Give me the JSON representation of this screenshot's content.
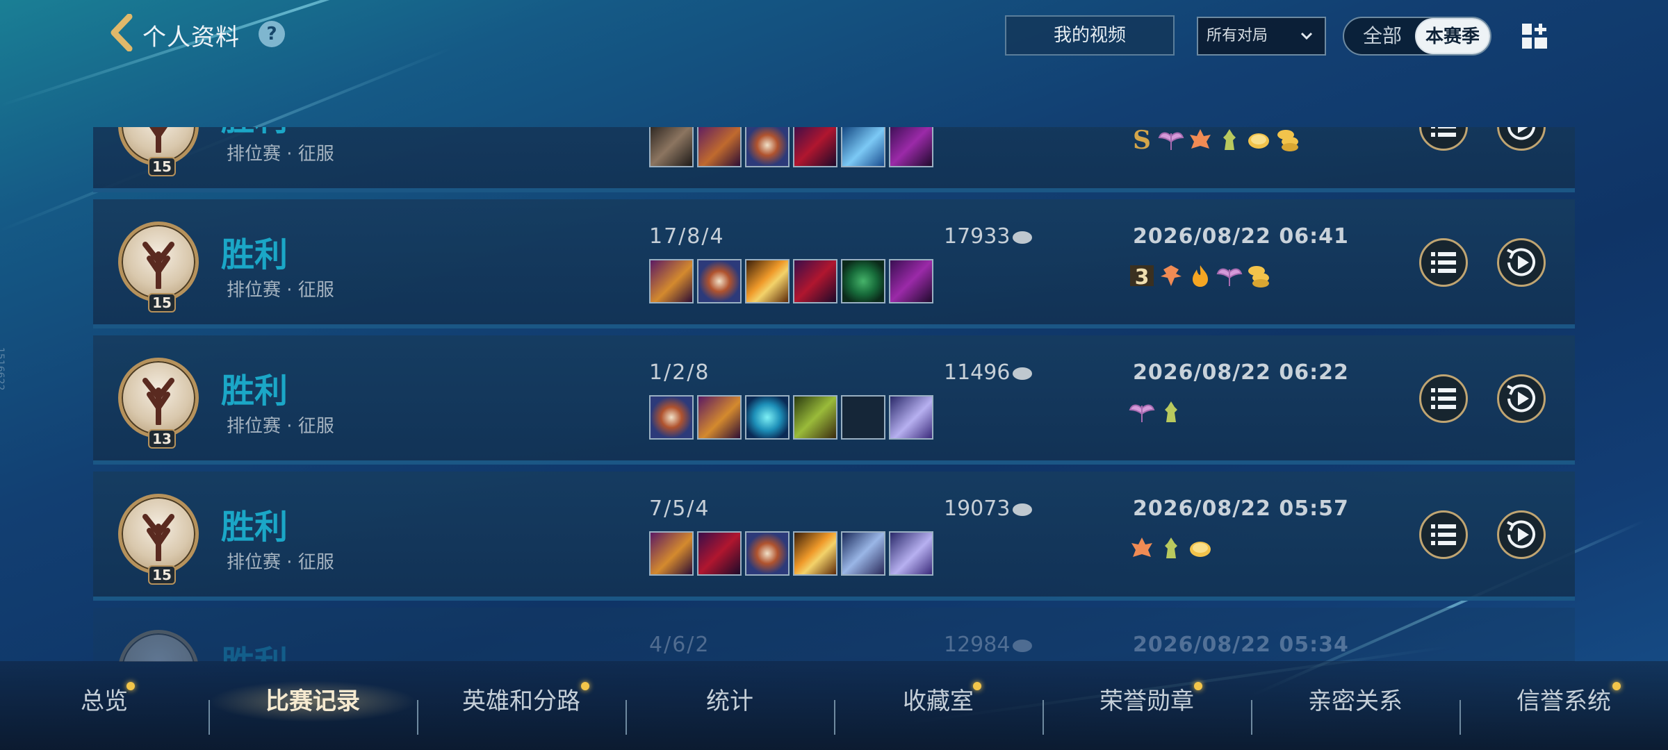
{
  "header": {
    "title": "个人资料",
    "help": "?",
    "my_videos": "我的视频",
    "filter": {
      "selected": "所有对局"
    },
    "toggle": {
      "all": "全部",
      "season": "本赛季"
    }
  },
  "matches": [
    {
      "result": "胜利",
      "mode": "排位赛 · 征服",
      "level": "15",
      "kda": "",
      "gold": "",
      "time": ""
    },
    {
      "result": "胜利",
      "mode": "排位赛 · 征服",
      "level": "15",
      "kda": "17/8/4",
      "gold": "17933",
      "time": "2026/08/22 06:41"
    },
    {
      "result": "胜利",
      "mode": "排位赛 · 征服",
      "level": "13",
      "kda": "1/2/8",
      "gold": "11496",
      "time": "2026/08/22 06:22"
    },
    {
      "result": "胜利",
      "mode": "排位赛 · 征服",
      "level": "15",
      "kda": "7/5/4",
      "gold": "19073",
      "time": "2026/08/22 05:57"
    },
    {
      "result": "胜利",
      "mode": "",
      "level": "",
      "kda": "4/6/2",
      "gold": "12984",
      "time": "2026/08/22 05:34"
    }
  ],
  "badge_text": {
    "s": "S",
    "three": "3"
  },
  "nav": {
    "tabs": [
      "总览",
      "比赛记录",
      "英雄和分路",
      "统计",
      "收藏室",
      "荣誉勋章",
      "亲密关系",
      "信誉系统"
    ],
    "active_index": 1
  },
  "side_id": "1516622",
  "colors": {
    "result_win": "#1ba7c7",
    "accent_gold": "#c0a572",
    "notify_dot": "#f3c54a"
  }
}
